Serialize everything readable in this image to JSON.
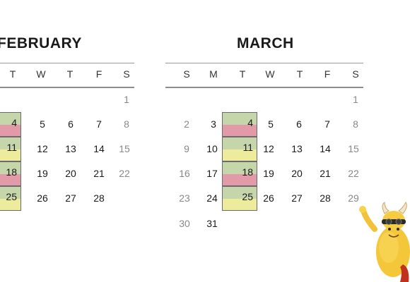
{
  "february": {
    "title": "FEBRUARY",
    "weekdays": [
      "T",
      "W",
      "T",
      "F",
      "S"
    ],
    "row1": {
      "sat": "1"
    },
    "row2": {
      "tue": "4",
      "wed": "5",
      "thu": "6",
      "fri": "7",
      "sat": "8"
    },
    "row3": {
      "tue": "11",
      "wed": "12",
      "thu": "13",
      "fri": "14",
      "sat": "15"
    },
    "row4": {
      "tue": "18",
      "wed": "19",
      "thu": "20",
      "fri": "21",
      "sat": "22"
    },
    "row5": {
      "tue": "25",
      "wed": "26",
      "thu": "27",
      "fri": "28"
    }
  },
  "march": {
    "title": "MARCH",
    "weekdays": [
      "S",
      "M",
      "T",
      "W",
      "T",
      "F",
      "S"
    ],
    "row1": {
      "sat": "1"
    },
    "row2": {
      "sun": "2",
      "mon": "3",
      "tue": "4",
      "wed": "5",
      "thu": "6",
      "fri": "7",
      "sat": "8"
    },
    "row3": {
      "sun": "9",
      "mon": "10",
      "tue": "11",
      "wed": "12",
      "thu": "13",
      "fri": "14",
      "sat": "15"
    },
    "row4": {
      "sun": "16",
      "mon": "17",
      "tue": "18",
      "wed": "19",
      "thu": "20",
      "fri": "21",
      "sat": "22"
    },
    "row5": {
      "sun": "23",
      "mon": "24",
      "tue": "25",
      "wed": "26",
      "thu": "27",
      "fri": "28",
      "sat": "29"
    },
    "row6": {
      "sun": "30",
      "mon": "31"
    }
  },
  "colors": {
    "green": "#c4d6aa",
    "pink": "#e29aa8",
    "yellow": "#ecec9c",
    "weekend": "#888888"
  },
  "mascot": {
    "icon": "yellow-monster-mascot-icon"
  }
}
